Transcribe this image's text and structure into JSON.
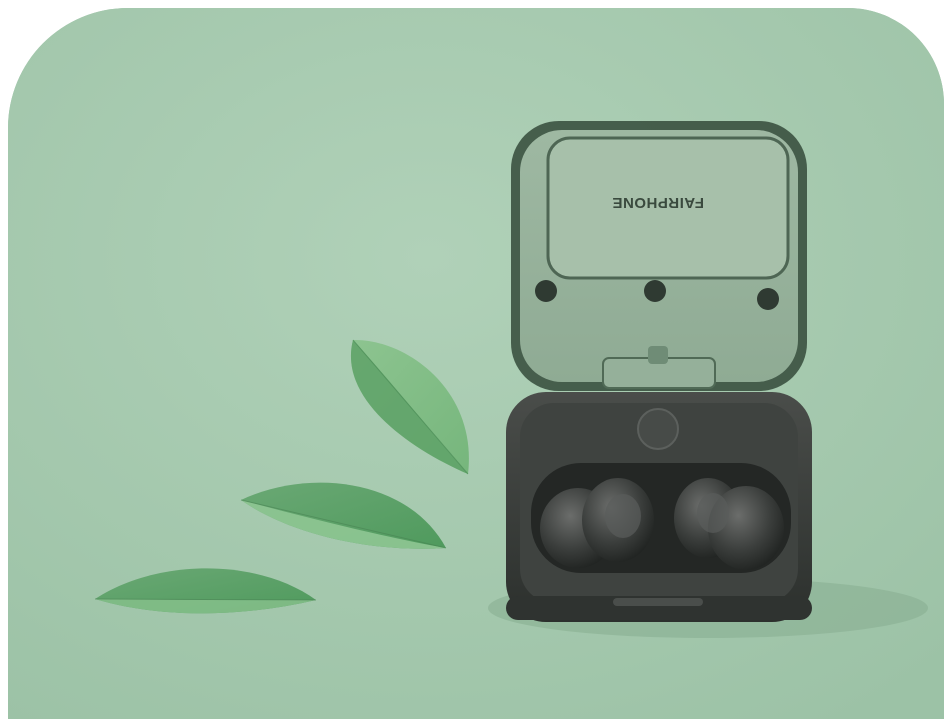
{
  "photo": {
    "brand_text": "FAIRPHONE"
  }
}
